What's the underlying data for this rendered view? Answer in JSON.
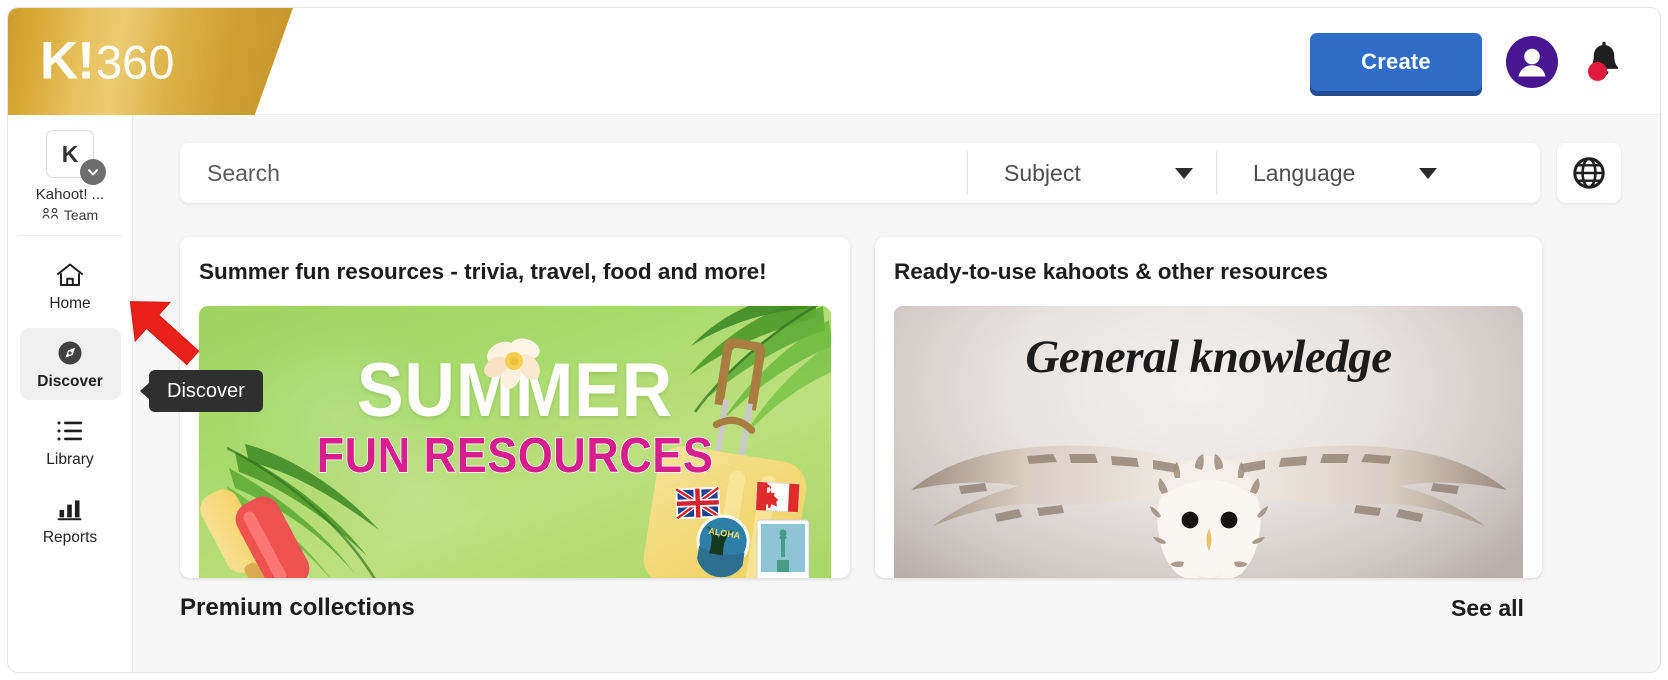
{
  "header": {
    "logo_k": "K!",
    "logo_360": "360",
    "create_label": "Create",
    "avatar_icon": "user-avatar-icon",
    "bell_icon": "notification-bell-icon",
    "bell_has_unread": true
  },
  "sidebar": {
    "org": {
      "initial": "K",
      "name": "Kahoot! ...",
      "team_label": "Team",
      "team_icon": "people-group-icon",
      "caret_icon": "chevron-down-icon"
    },
    "items": [
      {
        "id": "home",
        "label": "Home",
        "icon": "home-icon",
        "active": false
      },
      {
        "id": "discover",
        "label": "Discover",
        "icon": "compass-icon",
        "active": true
      },
      {
        "id": "library",
        "label": "Library",
        "icon": "list-icon",
        "active": false
      },
      {
        "id": "reports",
        "label": "Reports",
        "icon": "bar-chart-icon",
        "active": false
      }
    ]
  },
  "search": {
    "placeholder": "Search",
    "value": "",
    "subject_label": "Subject",
    "language_label": "Language",
    "globe_icon": "globe-icon",
    "caret_icon": "chevron-down-icon"
  },
  "cards": [
    {
      "id": "summer",
      "title": "Summer fun resources - trivia, travel, food and more!",
      "banner": {
        "line1": "SUMMER",
        "line2": "FUN RESOURCES",
        "bg_color": "#a9da6c",
        "line1_color": "#ffffff",
        "line2_color": "#d81e8f"
      }
    },
    {
      "id": "ready-to-use",
      "title": "Ready-to-use kahoots & other resources",
      "banner": {
        "line1": "General knowledge",
        "bg_color": "#e7e3e1",
        "line1_color": "#1c1c1c"
      }
    }
  ],
  "section": {
    "title": "Premium collections",
    "see_all": "See all"
  },
  "annotation": {
    "tooltip_text": "Discover",
    "tooltip_bg": "#2f2f2f",
    "arrow_color": "#e8211a"
  },
  "colors": {
    "brand_gold": "#d6a833",
    "create_blue": "#2f6dc9",
    "avatar_purple": "#46178f",
    "notification_red": "#e21b3c"
  }
}
